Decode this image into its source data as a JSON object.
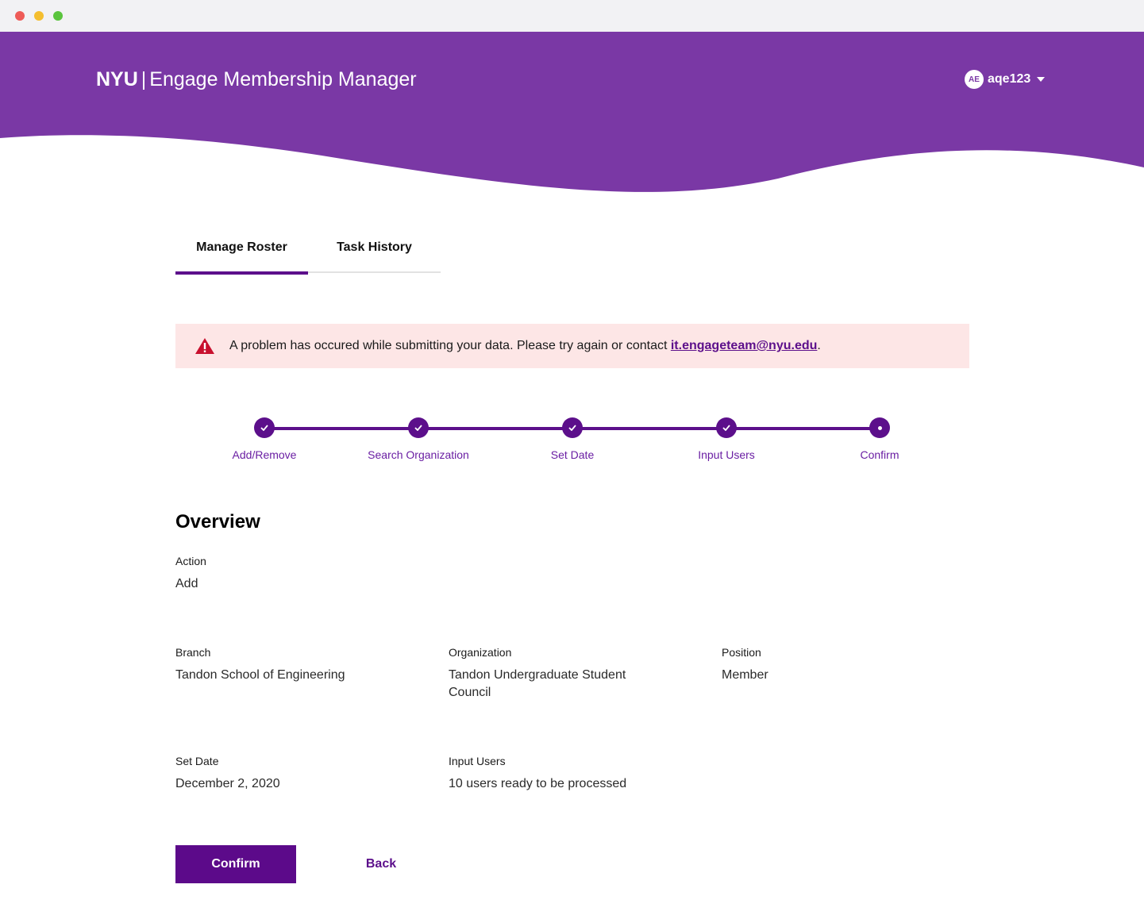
{
  "header": {
    "brand_short": "NYU",
    "separator": "|",
    "app_name": "Engage Membership Manager",
    "avatar_initials": "AE",
    "username": "aqe123",
    "brand_color": "#7a38a5"
  },
  "tabs": [
    {
      "label": "Manage Roster",
      "active": true
    },
    {
      "label": "Task History",
      "active": false
    }
  ],
  "alert": {
    "message": "A problem has occured while submitting your data. Please try again or contact ",
    "link_text": "it.engageteam@nyu.edu",
    "suffix": ".",
    "icon": "warning-triangle-icon",
    "background": "#fde6e6"
  },
  "stepper": {
    "steps": [
      {
        "label": "Add/Remove",
        "status": "complete"
      },
      {
        "label": "Search Organization",
        "status": "complete"
      },
      {
        "label": "Set Date",
        "status": "complete"
      },
      {
        "label": "Input Users",
        "status": "complete"
      },
      {
        "label": "Confirm",
        "status": "current"
      }
    ]
  },
  "overview": {
    "title": "Overview",
    "action": {
      "label": "Action",
      "value": "Add"
    },
    "branch": {
      "label": "Branch",
      "value": "Tandon School of Engineering"
    },
    "organization": {
      "label": "Organization",
      "value_line1": "Tandon Undergraduate Student",
      "value_line2": "Council"
    },
    "position": {
      "label": "Position",
      "value": "Member"
    },
    "set_date": {
      "label": "Set Date",
      "value": "December 2, 2020"
    },
    "input_users": {
      "label": "Input Users",
      "value": "10 users ready to be processed"
    }
  },
  "buttons": {
    "confirm": "Confirm",
    "back": "Back"
  },
  "colors": {
    "primary": "#5c0f8b",
    "header": "#7a38a5"
  }
}
